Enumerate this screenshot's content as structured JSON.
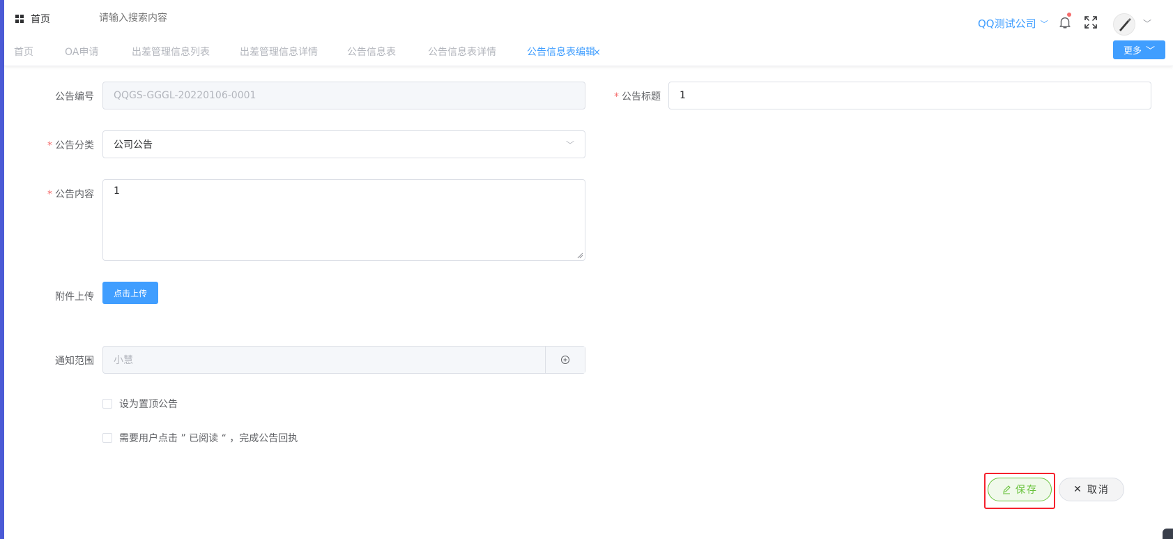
{
  "header": {
    "home_label": "首页",
    "search_placeholder": "请输入搜索内容",
    "company": "QQ测试公司",
    "icons": [
      "grid-icon",
      "bell-icon",
      "fullscreen-icon",
      "avatar",
      "chevron-down-icon"
    ]
  },
  "tabs": [
    {
      "label": "首页",
      "active": false
    },
    {
      "label": "OA申请",
      "active": false
    },
    {
      "label": "出差管理信息列表",
      "active": false
    },
    {
      "label": "出差管理信息详情",
      "active": false
    },
    {
      "label": "公告信息表",
      "active": false
    },
    {
      "label": "公告信息表详情",
      "active": false
    },
    {
      "label": "公告信息表编辑",
      "active": true
    }
  ],
  "tab_close": "×",
  "more_button": "更多",
  "form": {
    "number_label": "公告编号",
    "number_value": "QQGS-GGGL-20220106-0001",
    "title_label": "公告标题",
    "title_value": "1",
    "category_label": "公告分类",
    "category_value": "公司公告",
    "content_label": "公告内容",
    "content_value": "1",
    "attachment_label": "附件上传",
    "upload_button": "点击上传",
    "scope_label": "通知范围",
    "scope_value": "小慧",
    "pin_checkbox": "设为置顶公告",
    "receipt_checkbox": "需要用户点击 ” 已阅读 “ ，完成公告回执",
    "required_mark": "*"
  },
  "actions": {
    "save": "保存",
    "cancel": "取消"
  },
  "colors": {
    "accent": "#409eff",
    "save": "#67c23a",
    "required": "#f56c6c",
    "highlight": "#f5222d"
  }
}
